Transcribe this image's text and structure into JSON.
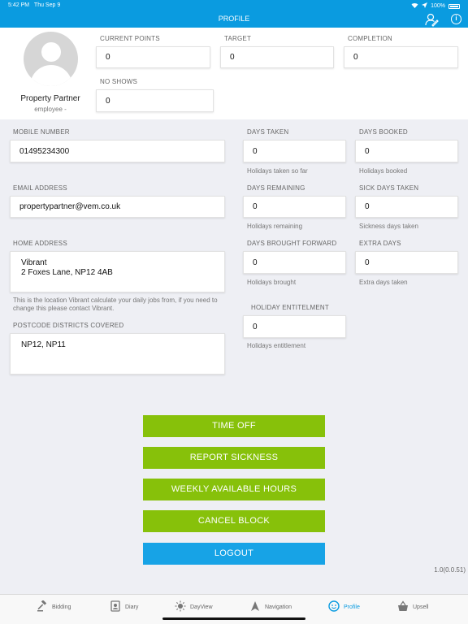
{
  "status_bar": {
    "time": "5:42 PM",
    "date": "Thu Sep 9",
    "battery": "100%"
  },
  "nav": {
    "title": "PROFILE",
    "right_icons": [
      "user-edit-icon",
      "info-icon"
    ],
    "info_glyph": "i"
  },
  "profile": {
    "name": "Property Partner",
    "role": "employee -"
  },
  "stats": {
    "current_points": {
      "label": "CURRENT POINTS",
      "value": "0"
    },
    "target": {
      "label": "TARGET",
      "value": "0"
    },
    "completion": {
      "label": "COMPLETION",
      "value": "0"
    },
    "no_shows": {
      "label": "NO SHOWS",
      "value": "0"
    }
  },
  "contact": {
    "mobile": {
      "label": "MOBILE NUMBER",
      "value": "01495234300"
    },
    "email": {
      "label": "EMAIL ADDRESS",
      "value": "propertypartner@vem.co.uk"
    },
    "home_address": {
      "label": "HOME ADDRESS",
      "line1": "Vibrant",
      "line2": "2 Foxes Lane, NP12 4AB",
      "note": "This is the location Vibrant calculate your daily jobs from, if you need to change this please contact Vibrant."
    },
    "postcodes": {
      "label": "POSTCODE DISTRICTS COVERED",
      "value": "NP12, NP11"
    }
  },
  "days": {
    "days_taken": {
      "label": "DAYS TAKEN",
      "value": "0",
      "hint": "Holidays taken so far"
    },
    "days_booked": {
      "label": "DAYS BOOKED",
      "value": "0",
      "hint": "Holidays booked"
    },
    "days_remaining": {
      "label": "DAYS REMAINING",
      "value": "0",
      "hint": "Holidays remaining"
    },
    "sick_days_taken": {
      "label": "SICK DAYS TAKEN",
      "value": "0",
      "hint": "Sickness days taken"
    },
    "days_brought_forward": {
      "label": "DAYS BROUGHT FORWARD",
      "value": "0",
      "hint": "Holidays brought"
    },
    "extra_days": {
      "label": "EXTRA DAYS",
      "value": "0",
      "hint": "Extra days taken"
    },
    "holiday_entitlement": {
      "label": "HOLIDAY ENTITELMENT",
      "value": "0",
      "hint": "Holidays entitlement"
    }
  },
  "buttons": {
    "time_off": "TIME OFF",
    "report_sickness": "REPORT SICKNESS",
    "weekly_hours": "WEEKLY AVAILABLE HOURS",
    "cancel_block": "CANCEL BLOCK",
    "logout": "LOGOUT"
  },
  "version": "1.0(0.0.51)",
  "tabs": [
    {
      "label": "Bidding",
      "icon": "gavel-icon"
    },
    {
      "label": "Diary",
      "icon": "diary-icon"
    },
    {
      "label": "DayView",
      "icon": "sun-icon"
    },
    {
      "label": "Navigation",
      "icon": "navigation-arrow-icon"
    },
    {
      "label": "Profile",
      "icon": "profile-face-icon",
      "active": true
    },
    {
      "label": "Upsell",
      "icon": "basket-icon"
    }
  ],
  "colors": {
    "primary_blue": "#0a9be0",
    "button_green": "#87c10a",
    "logout_blue": "#17a3e6",
    "background": "#eeeff4"
  }
}
